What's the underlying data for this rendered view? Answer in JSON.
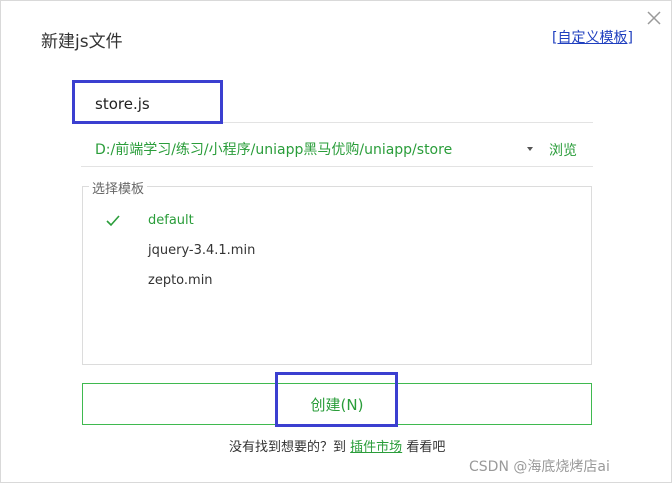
{
  "dialog": {
    "title": "新建js文件",
    "custom_template_prefix": "[",
    "custom_template_link": "自定义模板",
    "custom_template_suffix": "]"
  },
  "file_name": {
    "value": "store.js"
  },
  "location": {
    "path": "D:/前端学习/练习/小程序/uniapp黑马优购/uniapp/store",
    "browse_label": "浏览"
  },
  "templates": {
    "legend": "选择模板",
    "items": [
      {
        "label": "default",
        "selected": true
      },
      {
        "label": "jquery-3.4.1.min",
        "selected": false
      },
      {
        "label": "zepto.min",
        "selected": false
      }
    ]
  },
  "create_button": {
    "label": "创建(N)"
  },
  "footer": {
    "prefix": "没有找到想要的？到",
    "market_link": "插件市场",
    "suffix": "看看吧"
  },
  "watermark": "CSDN @海底烧烤店ai",
  "colors": {
    "accent_green": "#2a9d3a",
    "highlight_blue": "#3b3fd0",
    "link_blue": "#1f3fbf"
  }
}
